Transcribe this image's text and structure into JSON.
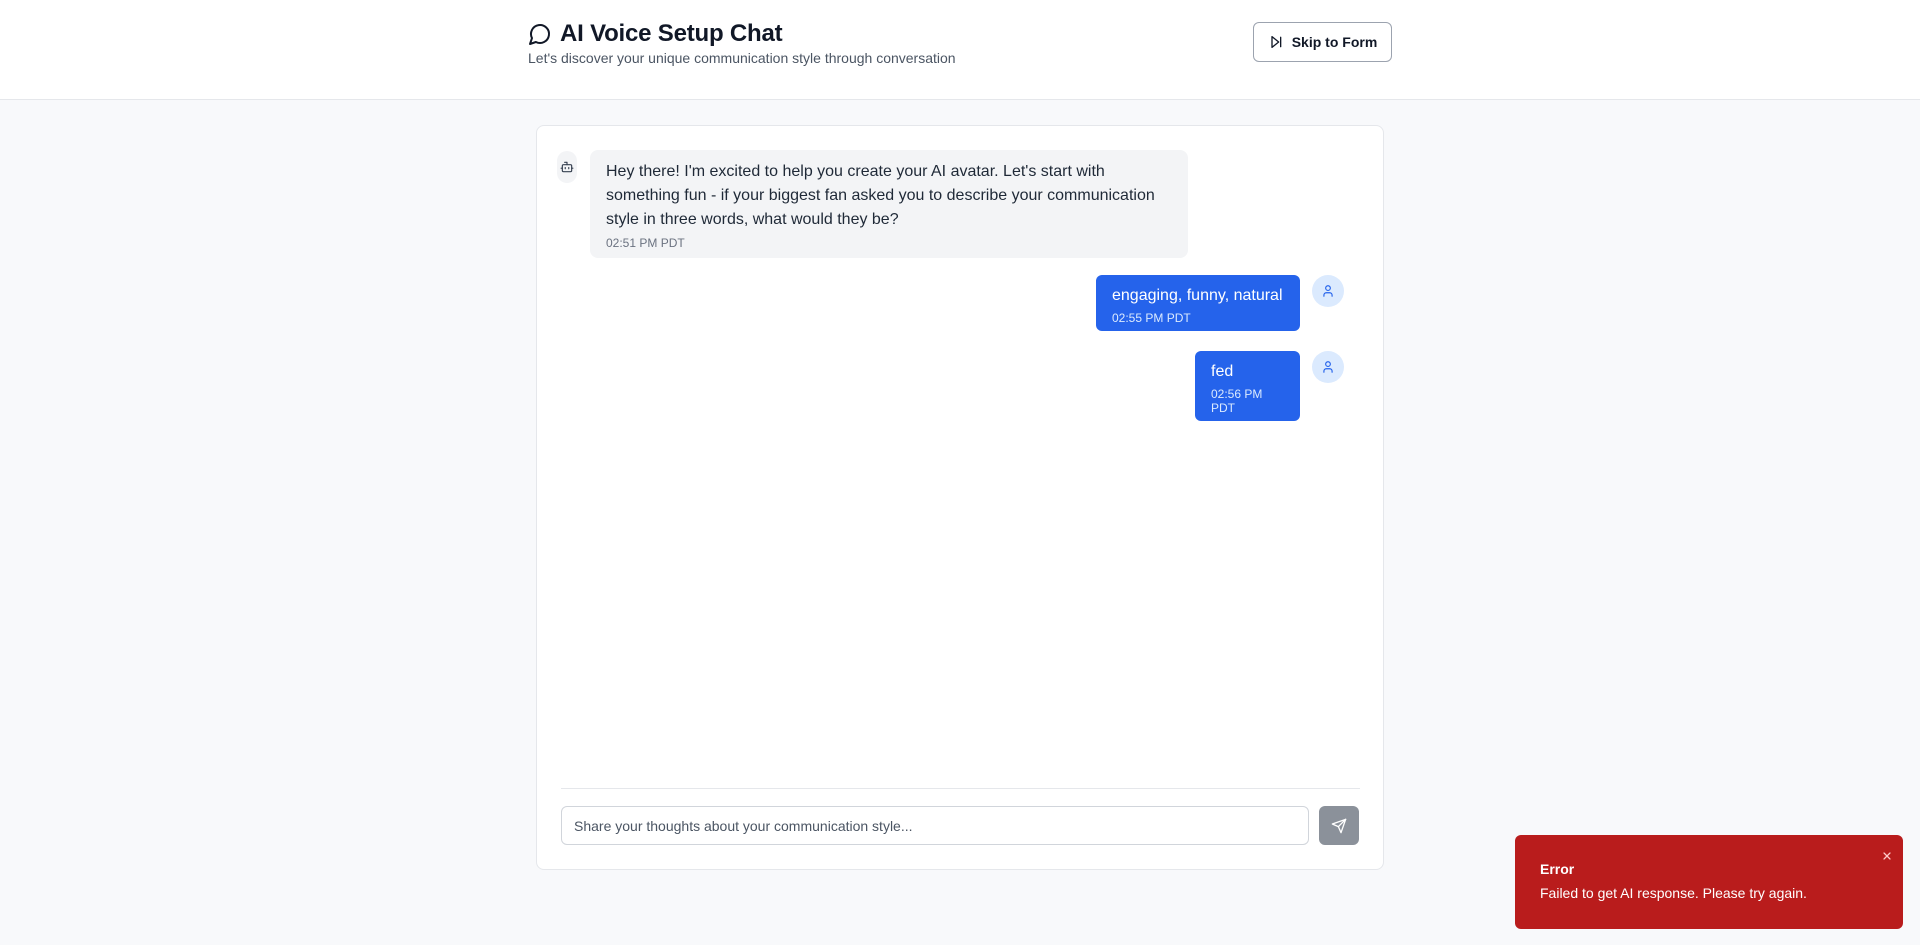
{
  "header": {
    "title": "AI Voice Setup Chat",
    "subtitle": "Let's discover your unique communication style through conversation",
    "title_icon": "message-circle-icon",
    "skip_label": "Skip to Form",
    "skip_icon": "skip-forward-icon"
  },
  "chat": {
    "messages": [
      {
        "sender": "bot",
        "text": "Hey there! I'm excited to help you create your AI avatar. Let's start with something fun - if your biggest fan asked you to describe your communication style in three words, what would they be?",
        "time": "02:51 PM PDT",
        "avatar_icon": "bot-icon"
      },
      {
        "sender": "user",
        "text": "engaging, funny, natural",
        "time": "02:55 PM PDT",
        "avatar_icon": "user-icon"
      },
      {
        "sender": "user",
        "text": "fed",
        "time": "02:56 PM PDT",
        "avatar_icon": "user-icon"
      }
    ]
  },
  "composer": {
    "placeholder": "Share your thoughts about your communication style...",
    "value": "",
    "send_icon": "send-icon"
  },
  "toast": {
    "title": "Error",
    "message": "Failed to get AI response. Please try again.",
    "close_icon": "close-icon"
  },
  "colors": {
    "accent": "#2563eb",
    "error": "#b91c1c",
    "send_disabled": "#8b919a",
    "page_bg": "#f8f9fb"
  }
}
